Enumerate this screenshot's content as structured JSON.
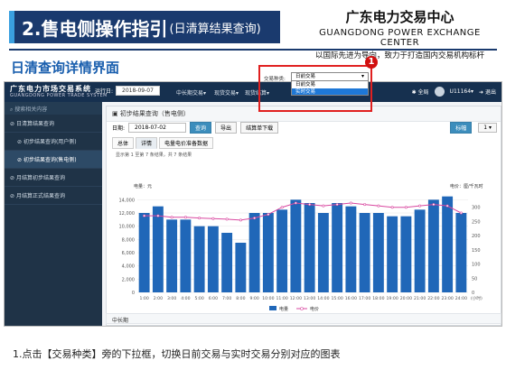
{
  "slide": {
    "title_main": "2.售电侧操作指引",
    "title_sub": "(日清算结果查询)",
    "company_cn": "广东电力交易中心",
    "company_en": "GUANGDONG POWER EXCHANGE CENTER",
    "company_slogan": "以国际先进为导向，致力于打造国内交易机构标杆",
    "section_title": "日清查询详情界面",
    "caption": "1.点击【交易种类】旁的下拉框，切换日前交易与实时交易分别对应的图表"
  },
  "app": {
    "logo_cn": "广东电力市场交易系统",
    "logo_en": "GUANGDONG POWER TRADE SYSTEM",
    "op_day_label": "运行日:",
    "op_day_value": "2018-09-07",
    "nav": [
      "中长期交易",
      "现货交易",
      "现货结算"
    ],
    "nav_arrow": "▾",
    "settings": "全局",
    "user": "U11164",
    "logout": "退出"
  },
  "sidebar": {
    "search": "搜索相关内容",
    "items": [
      {
        "label": "日清算结果查询",
        "sub": false,
        "active": false
      },
      {
        "label": "初步结果查询(用户侧)",
        "sub": true,
        "active": false
      },
      {
        "label": "初步结果查询(售电侧)",
        "sub": true,
        "active": true
      },
      {
        "label": "月结算初步结果查询",
        "sub": false,
        "active": false
      },
      {
        "label": "月结算正式结果查询",
        "sub": false,
        "active": false
      }
    ]
  },
  "main": {
    "panel_title": "初步结果查询（售电侧）",
    "date_label": "日期:",
    "date_value": "2018-07-02",
    "query_btn": "查询",
    "export_btn": "导出",
    "download_btn": "结算单下载",
    "unit_btn": "标幅",
    "page_value": "1",
    "tabs": [
      "总体",
      "详情",
      "电量电价准备数据"
    ],
    "summary": "显示第 1 至第 7 条结果，共 7 条结果",
    "dropdown_label": "交易种类:",
    "dropdown_value": "日前交易",
    "dropdown_options": [
      "日前交易",
      "实时交易"
    ],
    "badge": "1",
    "mid_section": "中长期"
  },
  "chart_data": {
    "type": "bar",
    "left_axis_label": "电量：元",
    "right_axis_label": "电价：厘/千瓦时",
    "x_unit": "(小时)",
    "categories": [
      "1:00",
      "2:00",
      "3:00",
      "4:00",
      "5:00",
      "6:00",
      "7:00",
      "8:00",
      "9:00",
      "10:00",
      "11:00",
      "12:00",
      "13:00",
      "14:00",
      "15:00",
      "16:00",
      "17:00",
      "18:00",
      "19:00",
      "20:00",
      "21:00",
      "22:00",
      "23:00",
      "24:00"
    ],
    "ylim": [
      0,
      15000
    ],
    "y2lim": [
      0,
      350
    ],
    "yticks": [
      "0",
      "2,000",
      "4,000",
      "6,000",
      "8,000",
      "10,000",
      "12,000",
      "14,000"
    ],
    "y2ticks": [
      "0",
      "50",
      "100",
      "150",
      "200",
      "250",
      "300"
    ],
    "series": [
      {
        "name": "电量",
        "values": [
          12000,
          13000,
          11000,
          11000,
          10000,
          10000,
          9000,
          7500,
          12000,
          12000,
          12500,
          14000,
          13500,
          12000,
          13500,
          13000,
          12000,
          12000,
          11500,
          11500,
          12500,
          14000,
          14500,
          12000
        ]
      },
      {
        "name": "电价",
        "values": [
          270,
          270,
          265,
          265,
          262,
          260,
          258,
          255,
          262,
          275,
          300,
          315,
          310,
          305,
          310,
          315,
          310,
          305,
          300,
          300,
          305,
          310,
          305,
          280
        ]
      }
    ],
    "colors": {
      "bar": "#2067b8",
      "line": "#d948a0"
    },
    "grid": true,
    "legend": "bottom"
  }
}
